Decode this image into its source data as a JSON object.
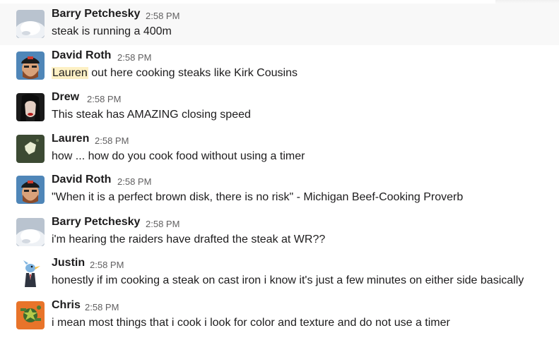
{
  "messages": [
    {
      "author": "Barry Petchesky",
      "time": "2:58 PM",
      "text": "steak is running a 400m",
      "avatar_icon": "snow-pile-avatar"
    },
    {
      "author": "David Roth",
      "time": "2:58 PM",
      "mention": "Lauren",
      "text": " out here cooking steaks like Kirk Cousins",
      "avatar_icon": "bearded-man-cap-avatar"
    },
    {
      "author": "Drew",
      "time": "2:58 PM",
      "text": "This steak has AMAZING closing speed",
      "avatar_icon": "dark-hair-face-avatar"
    },
    {
      "author": "Lauren",
      "time": "2:58 PM",
      "text": "how ... how do you cook food without using a timer",
      "avatar_icon": "green-shape-avatar"
    },
    {
      "author": "David Roth",
      "time": "2:58 PM",
      "text": "\"When it is a perfect brown disk, there is no risk\" - Michigan Beef-Cooking Proverb",
      "avatar_icon": "bearded-man-cap-avatar"
    },
    {
      "author": "Barry Petchesky",
      "time": "2:58 PM",
      "text": "i'm hearing the raiders have drafted the steak at WR??",
      "avatar_icon": "snow-pile-avatar"
    },
    {
      "author": "Justin",
      "time": "2:58 PM",
      "text": "honestly if im cooking a steak on cast iron i know it's just a few minutes on either side basically",
      "avatar_icon": "bird-in-suit-avatar"
    },
    {
      "author": "Chris",
      "time": "2:58 PM",
      "text": "i mean most things that i cook i look for color and texture and do not use a timer",
      "avatar_icon": "cartoon-turtle-avatar"
    }
  ]
}
